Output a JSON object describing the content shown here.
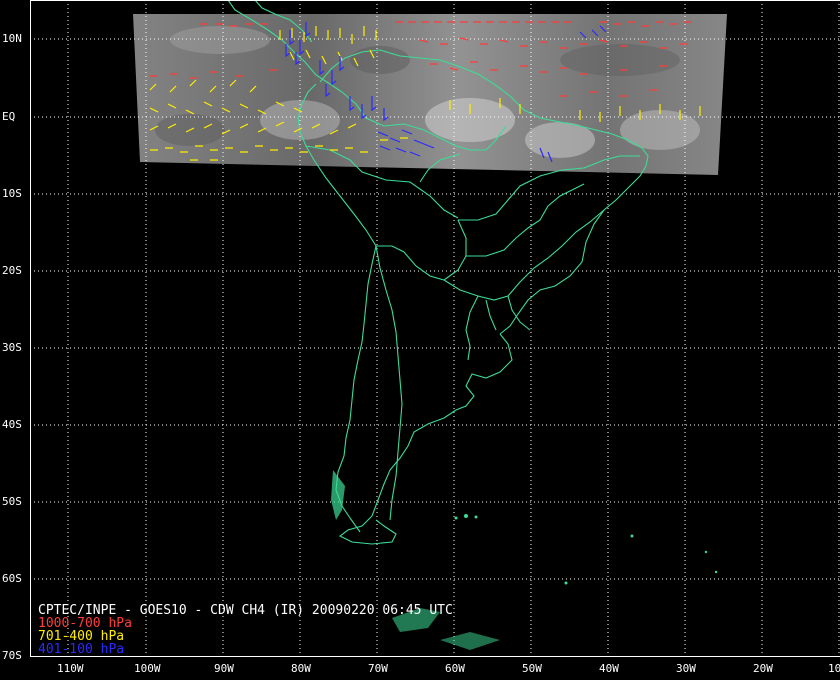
{
  "map": {
    "caption": {
      "title": "CPTEC/INPE - GOES10 - CDW CH4 (IR) 20090220 06:45 UTC",
      "legend": [
        {
          "label": "1000-700 hPa",
          "color": "#ff3b3b"
        },
        {
          "label": "701-400 hPa",
          "color": "#ffee00"
        },
        {
          "label": "401-100 hPa",
          "color": "#2a2aff"
        }
      ]
    },
    "lat_labels": [
      "10N",
      "EQ",
      "10S",
      "20S",
      "30S",
      "40S",
      "50S",
      "60S",
      "70S"
    ],
    "lon_labels": [
      "110W",
      "100W",
      "90W",
      "80W",
      "70W",
      "60W",
      "50W",
      "40W",
      "30W",
      "20W",
      "10"
    ],
    "colors": {
      "coastline": "#3ddc97",
      "grid": "#ffffff",
      "background": "#000000",
      "satellite_imagery": "#7a7a7a"
    }
  }
}
